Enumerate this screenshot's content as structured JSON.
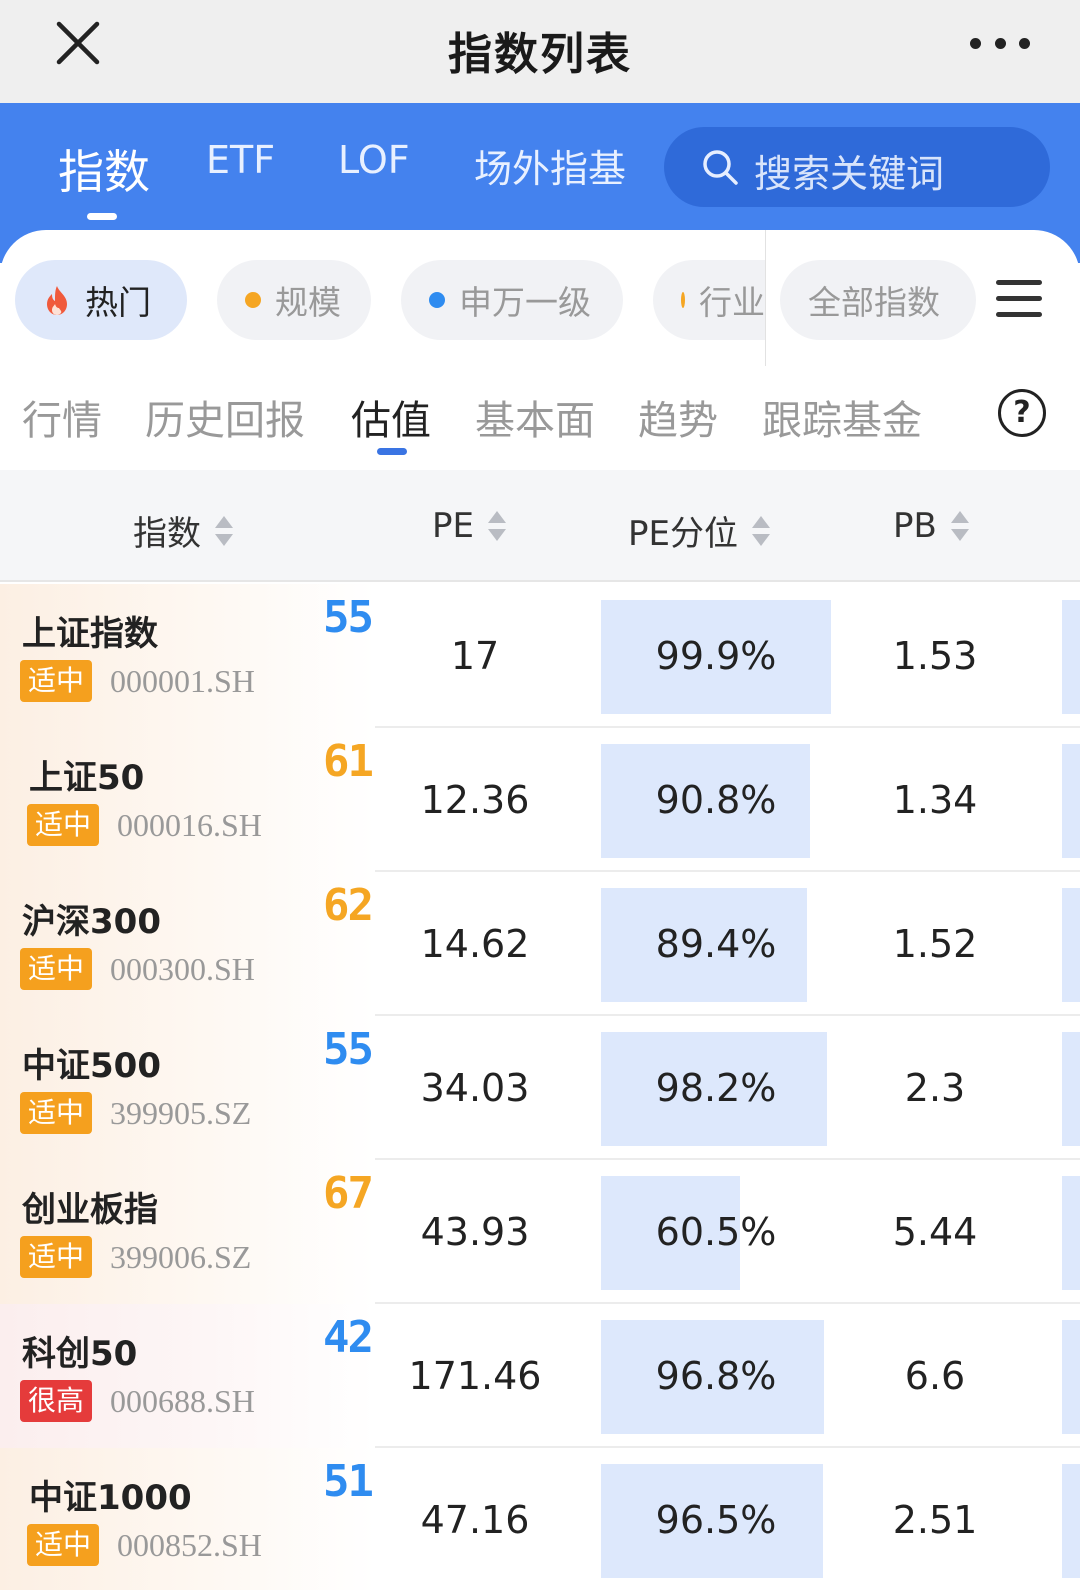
{
  "header": {
    "title": "指数列表"
  },
  "main_tabs": [
    {
      "label": "指数",
      "active": true
    },
    {
      "label": "ETF",
      "active": false
    },
    {
      "label": "LOF",
      "active": false
    },
    {
      "label": "场外指基",
      "active": false
    }
  ],
  "search": {
    "placeholder": "搜索关键词"
  },
  "categories": [
    {
      "label": "热门",
      "active": true,
      "icon": "fire-icon",
      "color": "#f05a3c"
    },
    {
      "label": "规模",
      "active": false,
      "dot_color": "#f5a623"
    },
    {
      "label": "申万一级",
      "active": false,
      "dot_color": "#2f8cf0"
    },
    {
      "label": "行业",
      "active": false,
      "dot_color": "#f5a623"
    },
    {
      "label": "全部指数",
      "active": false
    }
  ],
  "sub_tabs": [
    {
      "label": "行情",
      "active": false
    },
    {
      "label": "历史回报",
      "active": false
    },
    {
      "label": "估值",
      "active": true
    },
    {
      "label": "基本面",
      "active": false
    },
    {
      "label": "趋势",
      "active": false
    },
    {
      "label": "跟踪基金",
      "active": false
    }
  ],
  "help": {
    "label": "?"
  },
  "columns": [
    "指数",
    "PE",
    "PE分位",
    "PB"
  ],
  "rows": [
    {
      "name": "上证指数",
      "badge": "适中",
      "badge_level": "mid",
      "code": "000001.SH",
      "score": "55",
      "score_color": "#2f8cf0",
      "pe": "17",
      "pe_pct": "99.9%",
      "pe_pct_value": 99.9,
      "pb": "1.53"
    },
    {
      "name": "上证50",
      "badge": "适中",
      "badge_level": "mid",
      "code": "000016.SH",
      "score": "61",
      "score_color": "#f5a623",
      "pe": "12.36",
      "pe_pct": "90.8%",
      "pe_pct_value": 90.8,
      "pb": "1.34"
    },
    {
      "name": "沪深300",
      "badge": "适中",
      "badge_level": "mid",
      "code": "000300.SH",
      "score": "62",
      "score_color": "#f5a623",
      "pe": "14.62",
      "pe_pct": "89.4%",
      "pe_pct_value": 89.4,
      "pb": "1.52"
    },
    {
      "name": "中证500",
      "badge": "适中",
      "badge_level": "mid",
      "code": "399905.SZ",
      "score": "55",
      "score_color": "#2f8cf0",
      "pe": "34.03",
      "pe_pct": "98.2%",
      "pe_pct_value": 98.2,
      "pb": "2.3"
    },
    {
      "name": "创业板指",
      "badge": "适中",
      "badge_level": "mid",
      "code": "399006.SZ",
      "score": "67",
      "score_color": "#f5a623",
      "pe": "43.93",
      "pe_pct": "60.5%",
      "pe_pct_value": 60.5,
      "pb": "5.44"
    },
    {
      "name": "科创50",
      "badge": "很高",
      "badge_level": "high",
      "code": "000688.SH",
      "score": "42",
      "score_color": "#2f8cf0",
      "pe": "171.46",
      "pe_pct": "96.8%",
      "pe_pct_value": 96.8,
      "pb": "6.6"
    },
    {
      "name": "中证1000",
      "badge": "适中",
      "badge_level": "mid",
      "code": "000852.SH",
      "score": "51",
      "score_color": "#2f8cf0",
      "pe": "47.16",
      "pe_pct": "96.5%",
      "pe_pct_value": 96.5,
      "pb": "2.51"
    }
  ]
}
